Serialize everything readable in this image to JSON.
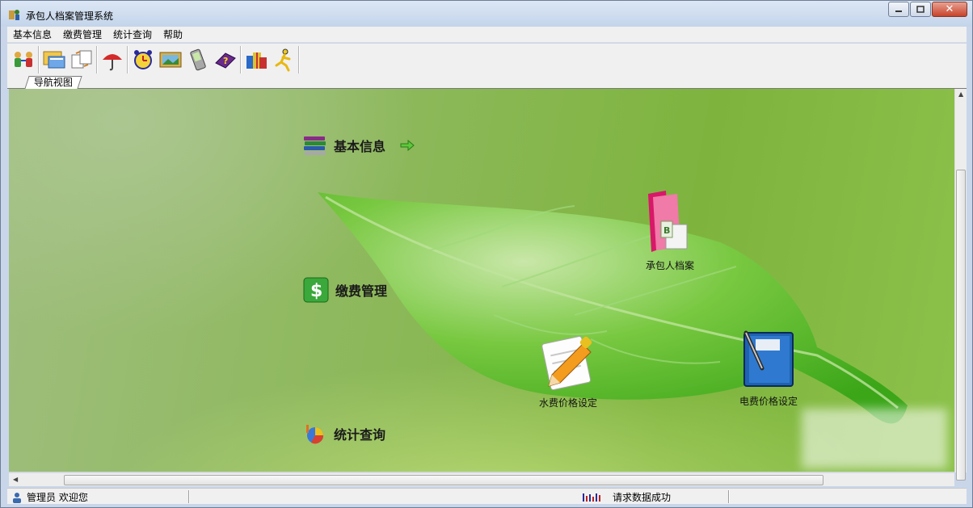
{
  "window": {
    "title": "承包人档案管理系统",
    "buttons": {
      "minimize": "−",
      "maximize": "□",
      "close": "✕"
    }
  },
  "menu": [
    "基本信息",
    "缴费管理",
    "统计查询",
    "帮助"
  ],
  "toolbar": {
    "buttons": [
      "users-transfer-icon",
      "folder-window-icon",
      "documents-exchange-icon",
      "umbrella-icon",
      "alarm-clock-icon",
      "landscape-picture-icon",
      "handheld-device-icon",
      "help-book-icon",
      "gift-boxes-icon",
      "runner-icon"
    ]
  },
  "tab": {
    "label": "导航视图"
  },
  "nav": {
    "sections": [
      {
        "label": "基本信息",
        "icon": "books-stack-icon",
        "arrow": "green-arrow-right-icon"
      },
      {
        "label": "缴费管理",
        "icon": "dollar-icon"
      },
      {
        "label": "统计查询",
        "icon": "pie-chart-icon"
      }
    ],
    "cards": [
      {
        "label": "承包人档案",
        "icon": "folder-cards-icon"
      },
      {
        "label": "水费价格设定",
        "icon": "paper-pencil-icon"
      },
      {
        "label": "电费价格设定",
        "icon": "notebook-pen-icon"
      }
    ]
  },
  "status": {
    "left": "管理员 欢迎您",
    "right": "请求数据成功"
  },
  "colors": {
    "content_green": "#7eb43e",
    "leaf_green": "#5fbf2a"
  }
}
